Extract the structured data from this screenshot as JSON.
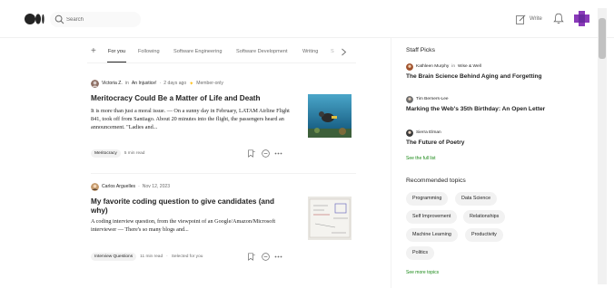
{
  "header": {
    "search_placeholder": "Search",
    "write_label": "Write",
    "icons": [
      "medium-logo-icon",
      "search-icon",
      "write-icon",
      "bell-icon",
      "avatar-icon"
    ]
  },
  "tabs": {
    "items": [
      "For you",
      "Following",
      "Software Engineering",
      "Software Development",
      "Writing",
      "S"
    ],
    "active": "For you"
  },
  "articles": [
    {
      "author": "Victoria Z.",
      "in_word": "in",
      "publication": "An Injustice!",
      "date": "2 days ago",
      "member": "Member-only",
      "title": "Meritocracy Could Be a Matter of Life and Death",
      "excerpt": "It is more than just a moral issue. — On a sunny day in February, LATAM Airline Flight 841, took off from Santiago. About 20 minutes into the flight, the passengers heard an announcement. \"Ladies and...",
      "tag": "Meritocracy",
      "read_time": "5 min read"
    },
    {
      "author": "Carlos Arguelles",
      "date": "Nov 12, 2023",
      "title": "My favorite coding question to give candidates (and why)",
      "excerpt": "A coding interview question, from the viewpoint of an Google/Amazon/Microsoft interviewer — There's so many blogs and...",
      "tag": "Interview Questions",
      "read_time": "11 min read",
      "selected": "Selected for you"
    }
  ],
  "sidebar": {
    "staff_picks_heading": "Staff Picks",
    "picks": [
      {
        "author": "Kathleen Murphy",
        "in_word": "in",
        "publication": "Wise & Well",
        "title": "The Brain Science Behind Aging and Forgetting"
      },
      {
        "author": "Tim Berners-Lee",
        "title": "Marking the Web's 35th Birthday: An Open Letter"
      },
      {
        "author": "Sierra Elman",
        "title": "The Future of Poetry"
      }
    ],
    "see_full_list": "See the full list",
    "recommended_heading": "Recommended topics",
    "topics": [
      "Programming",
      "Data Science",
      "Self Improvement",
      "Relationships",
      "Machine Learning",
      "Productivity",
      "Politics"
    ],
    "see_more_topics": "See more topics"
  },
  "colors": {
    "text": "#242424",
    "muted": "#6b6b6b",
    "green": "#1a8917",
    "member_star": "#ffc017",
    "avatar": "#8a3ab9"
  }
}
